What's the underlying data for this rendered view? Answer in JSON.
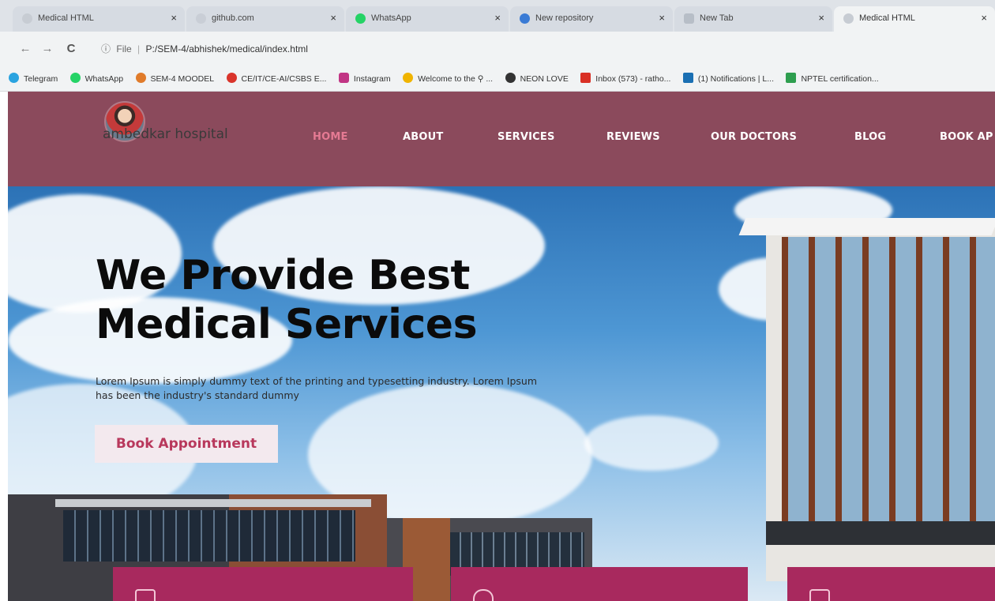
{
  "browser": {
    "tabs": [
      {
        "label": "Medical HTML",
        "favicon": "document-icon"
      },
      {
        "label": "github.com",
        "favicon": "github-icon"
      },
      {
        "label": "WhatsApp",
        "favicon": "whatsapp-icon"
      },
      {
        "label": "New repository",
        "favicon": "github-icon"
      },
      {
        "label": "New Tab",
        "favicon": "newtab-icon"
      },
      {
        "label": "Medical HTML",
        "favicon": "globe-icon"
      }
    ],
    "close_glyph": "×",
    "back_glyph": "←",
    "forward_glyph": "→",
    "reload_glyph": "C",
    "address": {
      "info_glyph": "ⓘ",
      "scheme": "File",
      "separator": "|",
      "url": "P:/SEM-4/abhishek/medical/index.html"
    },
    "bookmarks": [
      {
        "label": "Telegram",
        "color": "#2aa3e0"
      },
      {
        "label": "WhatsApp",
        "color": "#25d366"
      },
      {
        "label": "SEM-4 MOODEL",
        "color": "#e07b2a"
      },
      {
        "label": "CE/IT/CE-AI/CSBS E...",
        "color": "#d9342b"
      },
      {
        "label": "Instagram",
        "color": "#c13584"
      },
      {
        "label": "Welcome to the ⚲ ...",
        "color": "#f0b400"
      },
      {
        "label": "NEON LOVE",
        "color": "#333333"
      },
      {
        "label": "Inbox (573) - ratho...",
        "color": "#d93025"
      },
      {
        "label": "(1) Notifications | L...",
        "color": "#1a6fb3"
      },
      {
        "label": "NPTEL certification...",
        "color": "#2e9e4f"
      }
    ]
  },
  "site": {
    "logo_text": "ambedkar hospital",
    "nav": [
      "HOME",
      "ABOUT",
      "SERVICES",
      "REVIEWS",
      "OUR DOCTORS",
      "BLOG",
      "BOOK AP"
    ],
    "hero": {
      "title_line1": "We Provide Best",
      "title_line2": "Medical Services",
      "subtitle": "Lorem Ipsum is simply dummy text of the printing and typesetting industry. Lorem Ipsum has been the industry's standard dummy",
      "button": "Book Appointment"
    }
  },
  "colors": {
    "header_bg": "#8b4a5c",
    "nav_active": "#e57a93",
    "card_bg": "#a8295e",
    "button_text": "#b8385c"
  }
}
